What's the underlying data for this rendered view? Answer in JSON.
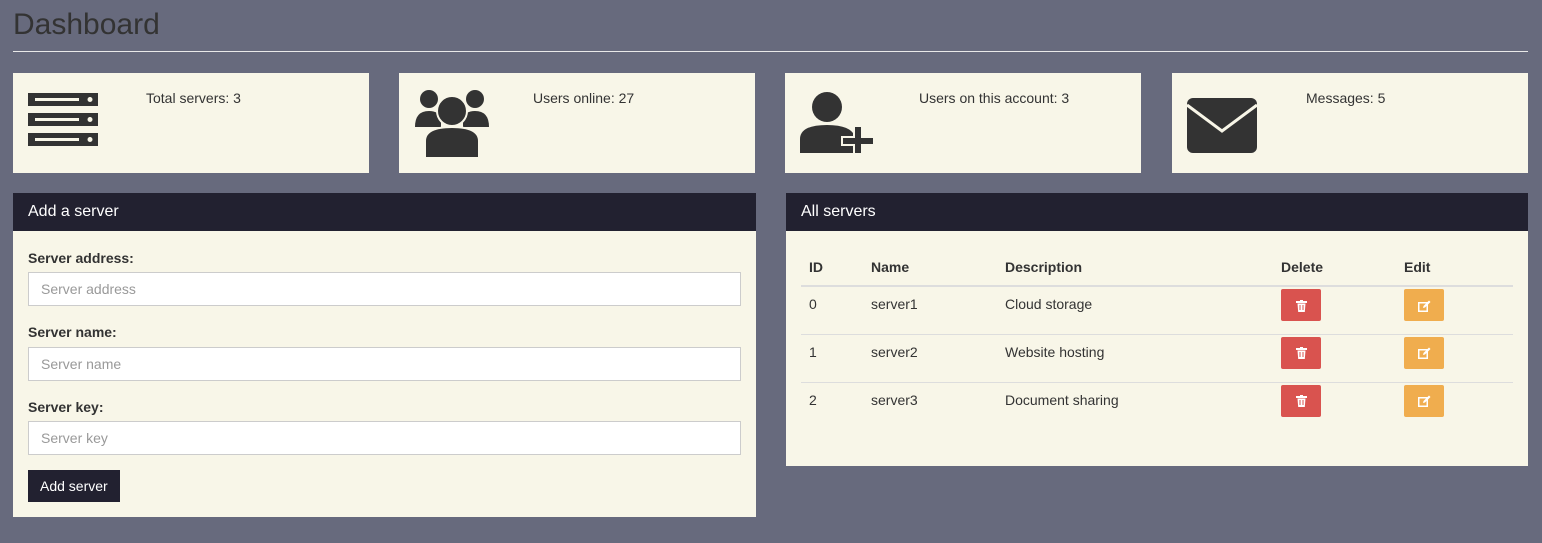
{
  "page": {
    "title": "Dashboard"
  },
  "stats": [
    {
      "icon": "server-icon",
      "text": "Total servers: 3"
    },
    {
      "icon": "users-icon",
      "text": "Users online: 27"
    },
    {
      "icon": "user-plus-icon",
      "text": "Users on this account: 3"
    },
    {
      "icon": "envelope-icon",
      "text": "Messages: 5"
    }
  ],
  "add_server": {
    "header": "Add a server",
    "address_label": "Server address:",
    "address_placeholder": "Server address",
    "name_label": "Server name:",
    "name_placeholder": "Server name",
    "key_label": "Server key:",
    "key_placeholder": "Server key",
    "submit_label": "Add server"
  },
  "all_servers": {
    "header": "All servers",
    "columns": [
      "ID",
      "Name",
      "Description",
      "Delete",
      "Edit"
    ],
    "rows": [
      {
        "id": "0",
        "name": "server1",
        "description": "Cloud storage"
      },
      {
        "id": "1",
        "name": "server2",
        "description": "Website hosting"
      },
      {
        "id": "2",
        "name": "server3",
        "description": "Document sharing"
      }
    ]
  },
  "colors": {
    "background": "#676a7d",
    "card": "#f8f6e8",
    "header": "#222130",
    "delete": "#d9534f",
    "edit": "#f0ad4e"
  }
}
